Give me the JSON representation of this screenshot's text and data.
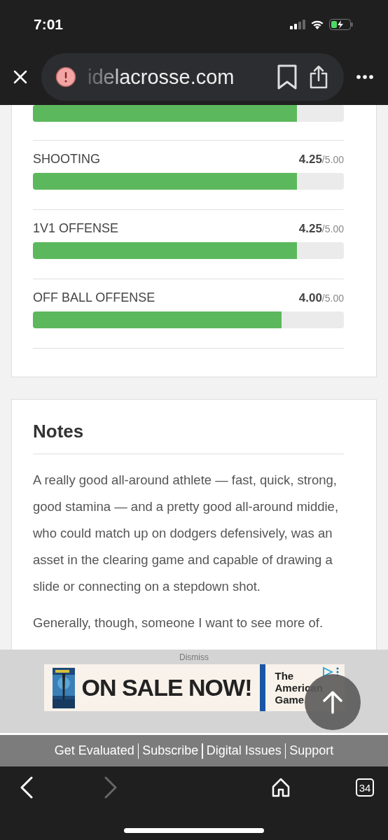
{
  "status_bar": {
    "time": "7:01"
  },
  "browser": {
    "url": "idelacrosse.com",
    "tab_count": "34"
  },
  "partial_bar": {
    "level": 0.85
  },
  "ratings": [
    {
      "label": "SHOOTING",
      "score": "4.25",
      "max": "/5.00",
      "level": 0.85
    },
    {
      "label": "1V1 OFFENSE",
      "score": "4.25",
      "max": "/5.00",
      "level": 0.85
    },
    {
      "label": "OFF BALL OFFENSE",
      "score": "4.00",
      "max": "/5.00",
      "level": 0.8
    }
  ],
  "notes": {
    "title": "Notes",
    "paragraphs": [
      "A really good all-around athlete — fast, quick, strong, good stamina — and a pretty good all-around middie, who could match up on dodgers defensively, was an asset in the clearing game and capable of drawing a slide or connecting on a stepdown shot.",
      "Generally, though, someone I want to see more of."
    ]
  },
  "ad": {
    "dismiss": "Dismiss",
    "headline": "ON SALE NOW!",
    "side_text": [
      "The",
      "American",
      "Game"
    ]
  },
  "footer_links": [
    "Get Evaluated",
    "Subscribe",
    "Digital Issues",
    "Support"
  ]
}
